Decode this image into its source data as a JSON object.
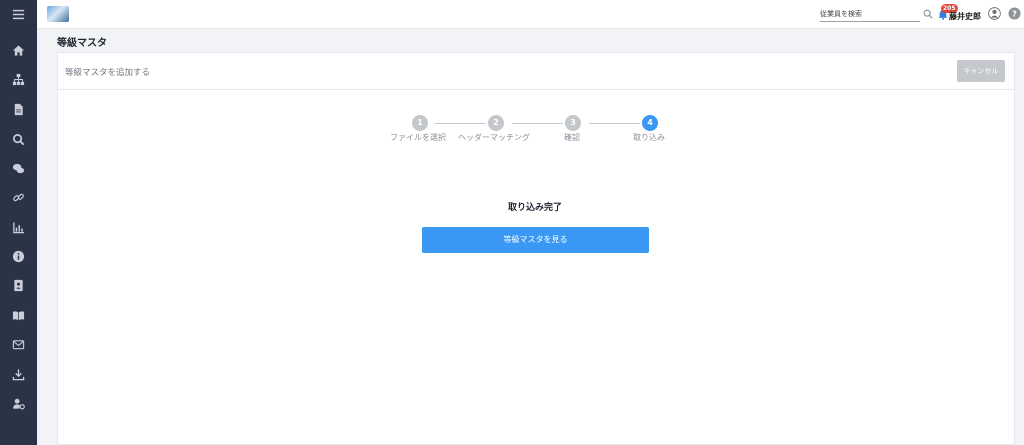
{
  "topbar": {
    "search_label": "従業員を検索",
    "notification_count": "205",
    "user_name": "藤井史郎"
  },
  "sidebar": {
    "items": [
      {
        "icon": "menu-icon"
      },
      {
        "icon": "home-icon"
      },
      {
        "icon": "org-chart-icon"
      },
      {
        "icon": "document-icon"
      },
      {
        "icon": "search-icon"
      },
      {
        "icon": "chat-icon"
      },
      {
        "icon": "link-icon"
      },
      {
        "icon": "chart-icon"
      },
      {
        "icon": "info-icon"
      },
      {
        "icon": "contact-card-icon"
      },
      {
        "icon": "book-icon"
      },
      {
        "icon": "mail-icon"
      },
      {
        "icon": "download-icon"
      },
      {
        "icon": "user-settings-icon"
      }
    ]
  },
  "page": {
    "title": "等級マスタ",
    "card_title": "等級マスタを追加する",
    "cancel_label": "キャンセル"
  },
  "steps": [
    {
      "number": "1",
      "label": "ファイルを選択",
      "active": false
    },
    {
      "number": "2",
      "label": "ヘッダーマッチング",
      "active": false
    },
    {
      "number": "3",
      "label": "確認",
      "active": false
    },
    {
      "number": "4",
      "label": "取り込み",
      "active": true
    }
  ],
  "result": {
    "message": "取り込み完了",
    "button_label": "等級マスタを見る"
  },
  "colors": {
    "sidebar": "#2b3347",
    "primary": "#3a98f5",
    "inactive": "#c4c7cc",
    "badge": "#e0453a"
  }
}
